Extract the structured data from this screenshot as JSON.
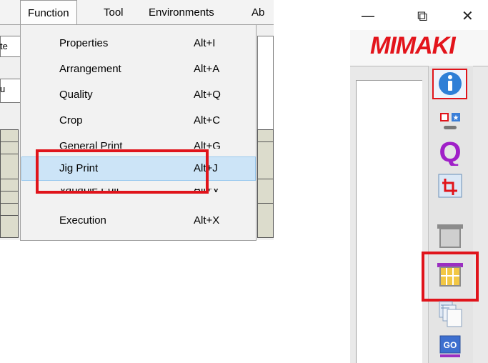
{
  "menubar": {
    "items": [
      "Function",
      "Tool",
      "Environments",
      "Ab"
    ],
    "open_menu": "Function"
  },
  "function_menu": {
    "items": [
      {
        "label": "Properties",
        "shortcut": "Alt+I"
      },
      {
        "label": "Arrangement",
        "shortcut": "Alt+A"
      },
      {
        "label": "Quality",
        "shortcut": "Alt+Q"
      },
      {
        "label": "Crop",
        "shortcut": "Alt+C"
      },
      {
        "label": "General Print",
        "shortcut": "Alt+G"
      },
      {
        "label": "Jig Print",
        "shortcut": "Alt+J"
      },
      {
        "label": "Variable Edit",
        "shortcut": "Alt+V"
      },
      {
        "label": "Execution",
        "shortcut": "Alt+X"
      }
    ],
    "selected": "Jig Print"
  },
  "background_fragments": [
    "te",
    "u"
  ],
  "window_controls": {
    "minimize": "—",
    "restore": "⧉",
    "close": "✕"
  },
  "brand": {
    "logo_text": "MIMAKI",
    "color": "#e3141b"
  },
  "toolbar_icons": [
    {
      "name": "info-icon",
      "highlighted": true
    },
    {
      "name": "layout-icon",
      "highlighted": false
    },
    {
      "name": "quality-q-icon",
      "highlighted": false
    },
    {
      "name": "crop-icon",
      "highlighted": false
    },
    {
      "name": "general-print-icon",
      "highlighted": false
    },
    {
      "name": "jig-print-icon",
      "highlighted": true
    },
    {
      "name": "variable-edit-icon",
      "highlighted": false
    },
    {
      "name": "go-execution-icon",
      "highlighted": false
    }
  ],
  "colors": {
    "highlight_red": "#e0141b",
    "selection_blue": "#cce4f7"
  }
}
